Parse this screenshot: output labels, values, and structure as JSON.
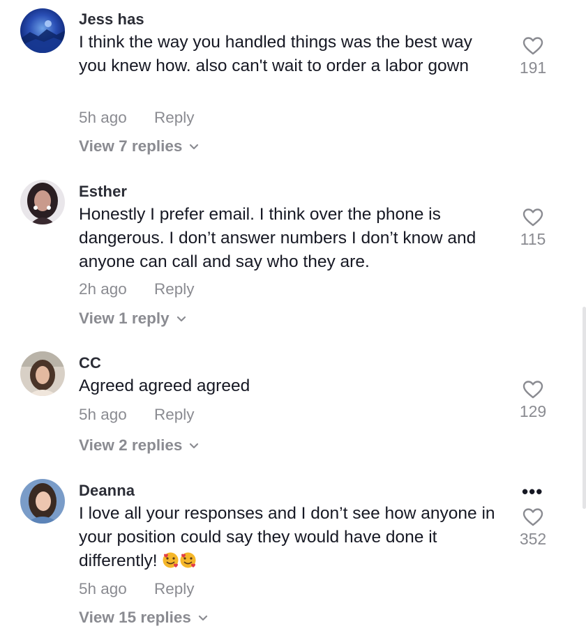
{
  "comments": [
    {
      "avatar_icon": "avatar-icon",
      "username": "Jess has",
      "text": "I think the way you handled things was the best way you knew how. also can't wait to order a labor gown",
      "time": "5h ago",
      "reply_label": "Reply",
      "view_replies": "View 7 replies",
      "likes": "191"
    },
    {
      "avatar_icon": "avatar-icon",
      "username": "Esther",
      "text": "Honestly I prefer email. I think over the phone is dangerous. I don’t answer numbers I don’t know and anyone can call and say who they are.",
      "time": "2h ago",
      "reply_label": "Reply",
      "view_replies": "View 1 reply",
      "likes": "115"
    },
    {
      "avatar_icon": "avatar-icon",
      "username": "CC",
      "text": "Agreed agreed agreed",
      "time": "5h ago",
      "reply_label": "Reply",
      "view_replies": "View 2 replies",
      "likes": "129"
    },
    {
      "avatar_icon": "avatar-icon",
      "username": "Deanna",
      "text": "I love all your responses and I don’t see how anyone in your position could say they would have done it differently! ",
      "emoji": "🥰🥰",
      "time": "5h ago",
      "reply_label": "Reply",
      "view_replies": "View 15 replies",
      "likes": "352",
      "more_label": "•••"
    }
  ],
  "icons": {
    "like": "heart-icon",
    "expand": "chevron-down-icon",
    "more": "more-options-icon"
  },
  "colors": {
    "text_primary": "#161823",
    "text_secondary": "#8a8b91"
  }
}
